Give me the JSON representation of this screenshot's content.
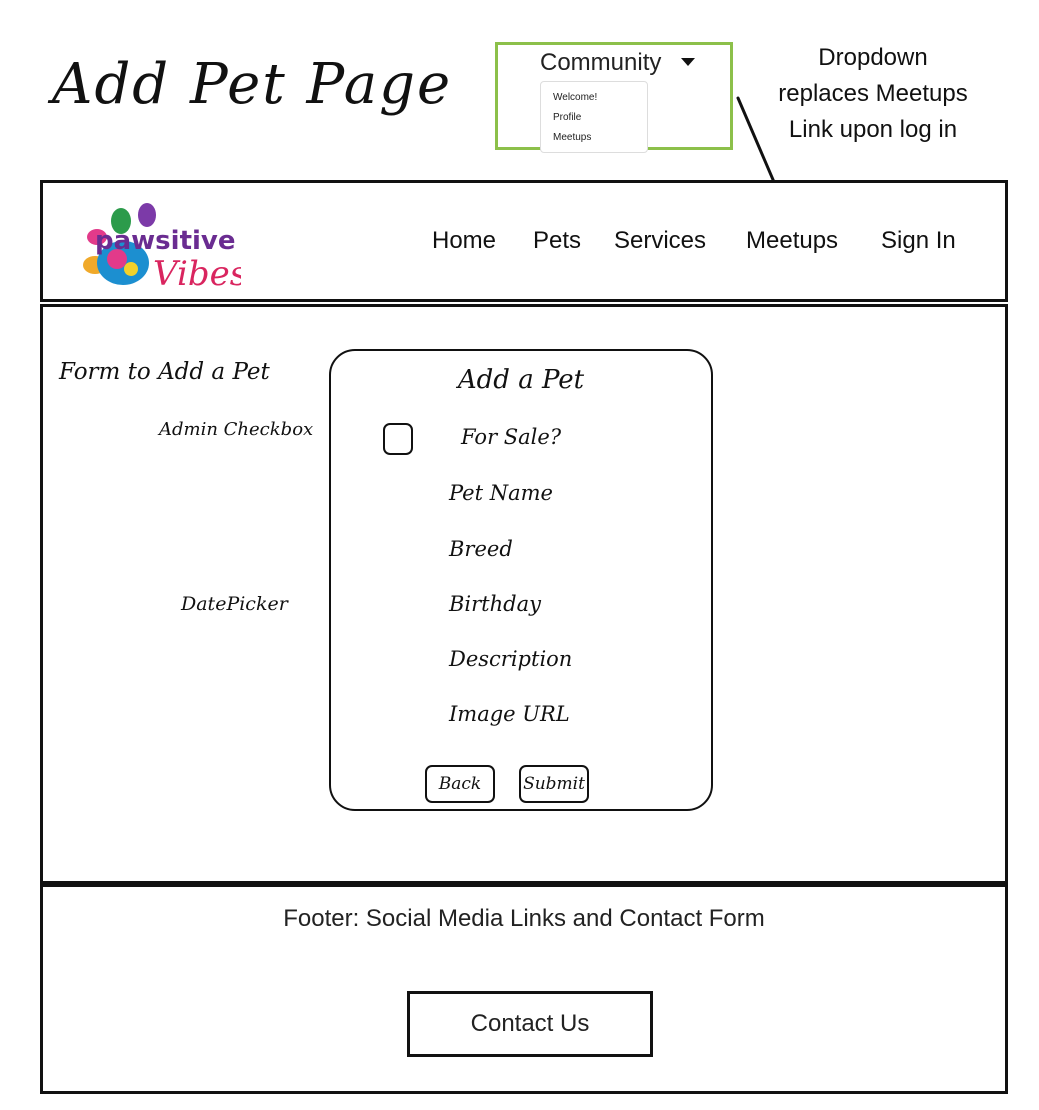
{
  "page_title": "Add Pet Page",
  "dropdown": {
    "label": "Community",
    "items": [
      "Welcome!",
      "Profile",
      "Meetups"
    ],
    "note": "Dropdown replaces Meetups Link upon log in",
    "border_color": "#8cc04a"
  },
  "header": {
    "logo_icon": "paw-logo-icon",
    "logo_text_1": "pawsitive",
    "logo_text_2": "Vibes",
    "nav": [
      "Home",
      "Pets",
      "Services",
      "Meetups",
      "Sign In"
    ]
  },
  "main": {
    "section_label": "Form to Add a Pet",
    "annotations": {
      "checkbox": "Admin Checkbox",
      "datepicker": "DatePicker"
    },
    "form": {
      "title": "Add a Pet",
      "for_sale_label": "For Sale?",
      "fields": [
        "Pet Name",
        "Breed",
        "Birthday",
        "Description",
        "Image URL"
      ],
      "back_label": "Back",
      "submit_label": "Submit"
    }
  },
  "footer": {
    "text": "Footer: Social Media Links and Contact Form",
    "contact_label": "Contact Us"
  }
}
